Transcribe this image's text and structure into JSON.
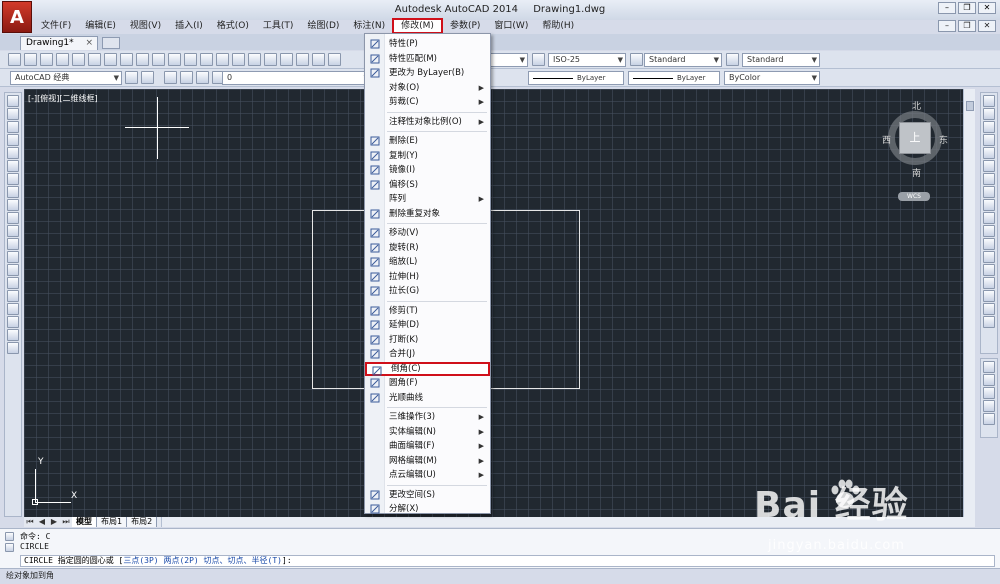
{
  "window": {
    "app_title": "Autodesk AutoCAD 2014",
    "document_title": "Drawing1.dwg",
    "logo_letter": "A"
  },
  "menubar": {
    "items": [
      "文件(F)",
      "编辑(E)",
      "视图(V)",
      "插入(I)",
      "格式(O)",
      "工具(T)",
      "绘图(D)",
      "标注(N)",
      "修改(M)",
      "参数(P)",
      "窗口(W)",
      "帮助(H)"
    ],
    "active": "修改(M)"
  },
  "tabs": {
    "doc_tab": "Drawing1*",
    "close_glyph": "×"
  },
  "toolbar": {
    "workspace": "AutoCAD 经典",
    "layer_value": "0",
    "text_style": "Standard",
    "dim_style": "ISO-25",
    "table_style": "Standard",
    "multileader_style": "Standard",
    "linetype_partial": "d",
    "linetype": "ByLayer",
    "lineweight": "ByLayer",
    "plotstyle": "ByColor"
  },
  "canvas": {
    "viewport_label": "[-][俯视][二维线框]",
    "viewcube": {
      "north": "北",
      "south": "南",
      "east": "东",
      "west": "西",
      "top": "上",
      "wcs": "WCS"
    },
    "ucs": {
      "x": "X",
      "y": "Y"
    },
    "background": "#212830"
  },
  "layout_tabs": {
    "tabs": [
      "模型",
      "布局1",
      "布局2"
    ],
    "active": "模型"
  },
  "command": {
    "history": [
      "命令: C",
      "CIRCLE"
    ],
    "prompt_prefix": "CIRCLE 指定圆的圆心或 [",
    "opt1": "三点(3P)",
    "opt2": "两点(2P)",
    "opt3": "切点、切点、半径(T)",
    "prompt_suffix": "]:"
  },
  "status": {
    "text": "绘对象加到角"
  },
  "modify_menu": {
    "items": [
      {
        "label": "特性(P)",
        "icon": "properties-icon"
      },
      {
        "label": "特性匹配(M)",
        "icon": "match-properties-icon"
      },
      {
        "label": "更改为 ByLayer(B)",
        "icon": "bylayer-icon"
      },
      {
        "label": "对象(O)",
        "submenu": true
      },
      {
        "label": "剪裁(C)",
        "submenu": true
      },
      {
        "label": "注释性对象比例(O)",
        "submenu": true
      },
      {
        "label": "删除(E)",
        "icon": "erase-icon"
      },
      {
        "label": "复制(Y)",
        "icon": "copy-icon"
      },
      {
        "label": "镜像(I)",
        "icon": "mirror-icon"
      },
      {
        "label": "偏移(S)",
        "icon": "offset-icon"
      },
      {
        "label": "阵列",
        "submenu": true
      },
      {
        "label": "删除重复对象",
        "icon": "overkill-icon"
      },
      {
        "label": "移动(V)",
        "icon": "move-icon"
      },
      {
        "label": "旋转(R)",
        "icon": "rotate-icon"
      },
      {
        "label": "缩放(L)",
        "icon": "scale-icon"
      },
      {
        "label": "拉伸(H)",
        "icon": "stretch-icon"
      },
      {
        "label": "拉长(G)",
        "icon": "lengthen-icon"
      },
      {
        "label": "修剪(T)",
        "icon": "trim-icon"
      },
      {
        "label": "延伸(D)",
        "icon": "extend-icon"
      },
      {
        "label": "打断(K)",
        "icon": "break-icon"
      },
      {
        "label": "合并(J)",
        "icon": "join-icon"
      },
      {
        "label": "倒角(C)",
        "icon": "chamfer-icon",
        "highlighted": true
      },
      {
        "label": "圆角(F)",
        "icon": "fillet-icon"
      },
      {
        "label": "光顺曲线",
        "icon": "blend-icon"
      },
      {
        "label": "三维操作(3)",
        "submenu": true
      },
      {
        "label": "实体编辑(N)",
        "submenu": true
      },
      {
        "label": "曲面编辑(F)",
        "submenu": true
      },
      {
        "label": "网格编辑(M)",
        "submenu": true
      },
      {
        "label": "点云编辑(U)",
        "submenu": true
      },
      {
        "label": "更改空间(S)",
        "icon": "change-space-icon"
      },
      {
        "label": "分解(X)",
        "icon": "explode-icon"
      }
    ],
    "highlight_color": "#d0101a"
  },
  "watermark": {
    "brand": "Bai 经验",
    "url": "jingyan.baidu.com"
  }
}
